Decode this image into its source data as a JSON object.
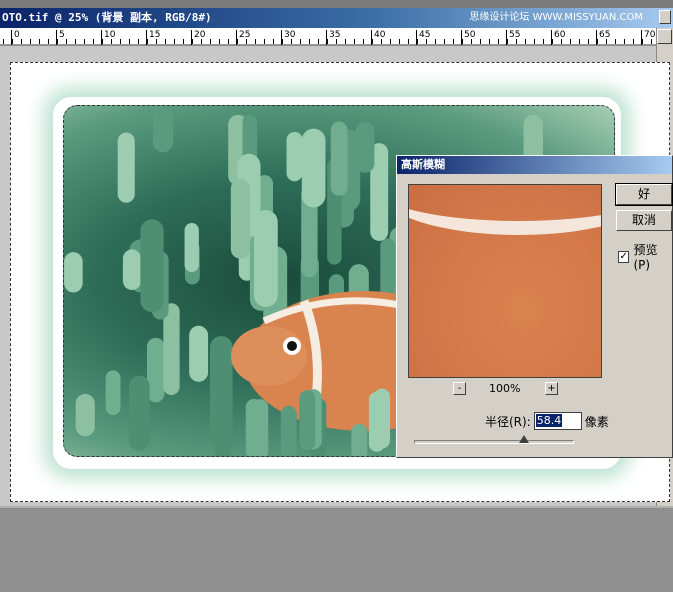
{
  "window": {
    "title": "OTO.tif @ 25% (背景 副本, RGB/8#)",
    "watermark": "思缘设计论坛 WWW.MISSYUAN.COM"
  },
  "ruler": {
    "labels": [
      "0",
      "5",
      "10",
      "15",
      "20",
      "25",
      "30",
      "35",
      "40",
      "45",
      "50",
      "55",
      "60",
      "65",
      "70"
    ]
  },
  "dialog": {
    "title": "高斯模糊",
    "ok_label": "好",
    "cancel_label": "取消",
    "preview_label": "预览(P)",
    "preview_checked": "✓",
    "zoom_out": "-",
    "zoom_in": "+",
    "zoom_value": "100%",
    "radius_label": "半径(R):",
    "radius_value": "58.4",
    "radius_unit": "像素",
    "slider_fraction": 0.68
  },
  "colors": {
    "titlebar": "#0a246a",
    "dialog_bg": "#d4d0c8",
    "fish": "#d9834e"
  }
}
